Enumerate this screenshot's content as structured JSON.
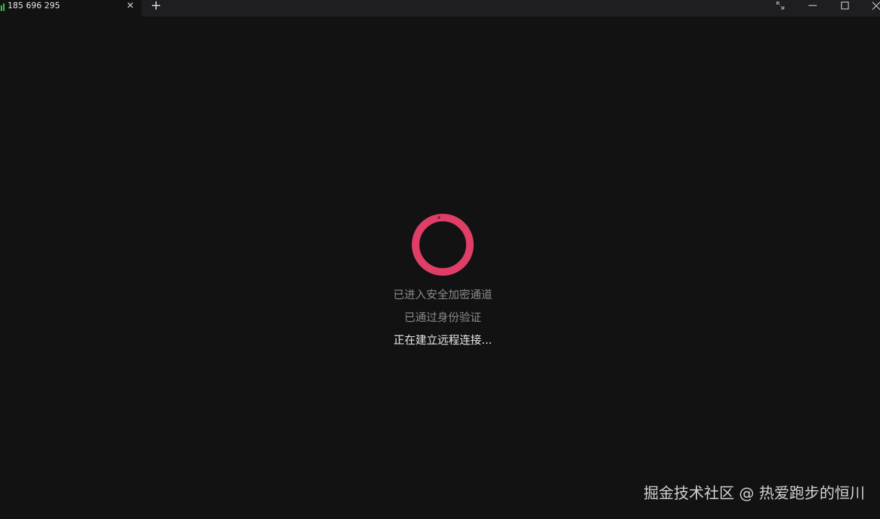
{
  "tab": {
    "title": "185 696 295",
    "signal_color": "#3bd14a"
  },
  "window": {
    "new_tab_icon": "plus-icon",
    "fullscreen_icon": "fullscreen-icon",
    "minimize_icon": "minimize-icon",
    "maximize_icon": "maximize-icon",
    "close_icon": "close-icon"
  },
  "loader": {
    "color": "#e03e66",
    "icon": "spinner-icon"
  },
  "status": {
    "line1": "已进入安全加密通道",
    "line2": "已通过身份验证",
    "line3": "正在建立远程连接..."
  },
  "watermark": {
    "text": "掘金技术社区 @ 热爱跑步的恒川"
  }
}
